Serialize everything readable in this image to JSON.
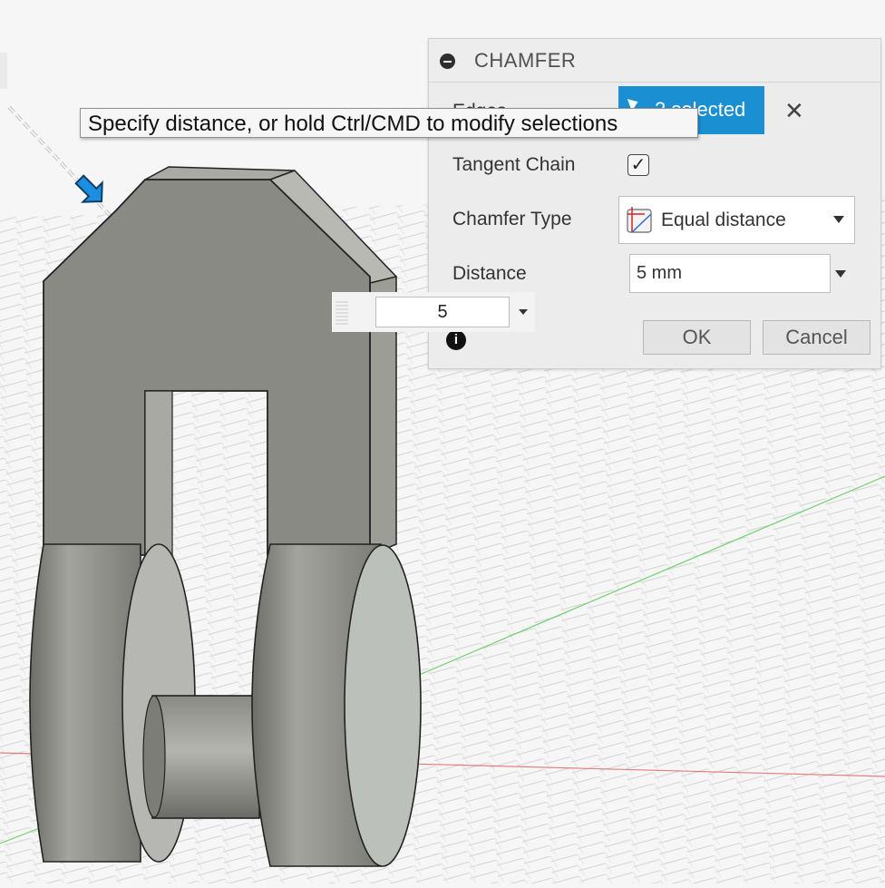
{
  "panel": {
    "title": "CHAMFER",
    "edges_label": "Edges",
    "edges_value": "2 selected",
    "clear_symbol": "✕",
    "tangent_chain_label": "Tangent Chain",
    "tangent_chain_checked": true,
    "check_symbol": "✓",
    "chamfer_type_label": "Chamfer Type",
    "chamfer_type_value": "Equal distance",
    "distance_label": "Distance",
    "distance_value": "5 mm",
    "ok_label": "OK",
    "cancel_label": "Cancel",
    "info_symbol": "i"
  },
  "tooltip": {
    "text": "Specify distance, or hold Ctrl/CMD to modify selections"
  },
  "floating_input": {
    "value": "5"
  },
  "colors": {
    "accent": "#1a8fd1",
    "body": "#8a8a84",
    "x_axis": "#e06060",
    "y_axis": "#70d070"
  }
}
